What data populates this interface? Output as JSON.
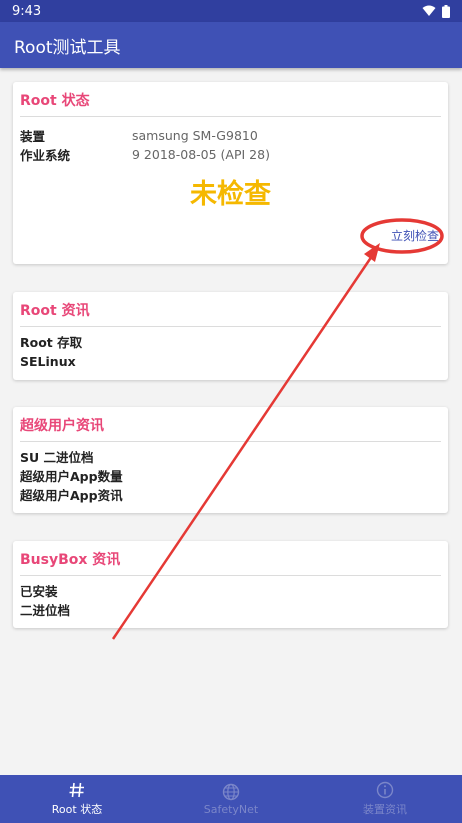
{
  "status_bar": {
    "time": "9:43"
  },
  "app_bar": {
    "title": "Root测试工具"
  },
  "root_status_card": {
    "title": "Root 状态",
    "rows": [
      {
        "label": "装置",
        "value": "samsung SM-G9810"
      },
      {
        "label": "作业系统",
        "value": "9 2018-08-05 (API 28)"
      }
    ],
    "status": "未检查",
    "check_link": "立刻检查"
  },
  "root_info_card": {
    "title": "Root 资讯",
    "rows": [
      "Root 存取",
      "SELinux"
    ]
  },
  "su_info_card": {
    "title": "超级用户资讯",
    "rows": [
      "SU 二进位档",
      "超级用户App数量",
      "超级用户App资讯"
    ]
  },
  "busybox_card": {
    "title": "BusyBox 资讯",
    "rows": [
      "已安装",
      "二进位档"
    ]
  },
  "bottom_nav": {
    "items": [
      {
        "label": "Root 状态",
        "icon": "hash-icon",
        "active": true
      },
      {
        "label": "SafetyNet",
        "icon": "globe-icon",
        "active": false
      },
      {
        "label": "装置资讯",
        "icon": "info-icon",
        "active": false
      }
    ]
  },
  "colors": {
    "primary": "#3f51b5",
    "primary_dark": "#303f9f",
    "accent_title": "#e84778",
    "status_yellow": "#f5b800",
    "annotation_red": "#e53935"
  }
}
